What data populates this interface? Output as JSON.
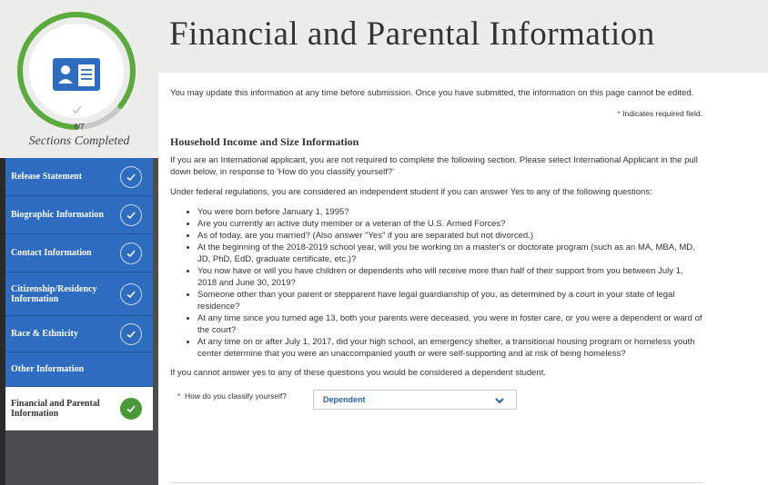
{
  "progress": {
    "count": "6/7",
    "label": "Sections Completed",
    "fraction": 0.857
  },
  "sidebar": {
    "items": [
      {
        "label": "Release Statement",
        "completed": true,
        "active": false
      },
      {
        "label": "Biographic Information",
        "completed": true,
        "active": false
      },
      {
        "label": "Contact Information",
        "completed": true,
        "active": false
      },
      {
        "label": "Citizenship/Residency Information",
        "completed": true,
        "active": false
      },
      {
        "label": "Race & Ethnicity",
        "completed": true,
        "active": false
      },
      {
        "label": "Other Information",
        "completed": false,
        "active": false
      },
      {
        "label": "Financial and Parental Information",
        "completed": true,
        "active": true
      }
    ]
  },
  "header": {
    "title": "Financial and Parental Information"
  },
  "main": {
    "intro": "You may update this information at any time before submission. Once you have submitted, the information on this page cannot be edited.",
    "required_star": "*",
    "required_note": "Indicates required field.",
    "section_heading": "Household Income and Size Information",
    "international_note": "If you are an International applicant, you are not required to complete the following section. Please select International Applicant in the pull down below, in response to 'How do you classify yourself?'",
    "federal_note": "Under federal regulations, you are considered an independent student if you can answer Yes to any of the following questions:",
    "questions": [
      "You were born before January 1, 1995?",
      "Are you currently an active duty member or a veteran of the U.S. Armed Forces?",
      "As of today, are you married? (Also answer \"Yes\" if you are separated but not divorced.)",
      "At the beginning of the 2018-2019 school year, will you be working on a master's or doctorate program (such as an MA, MBA, MD, JD, PhD, EdD, graduate certificate, etc.)?",
      "You now have or will you have children or dependents who will receive more than half of their support from you between July 1, 2018 and June 30, 2019?",
      "Someone other than your parent or stepparent have legal guardianship of you, as determined by a court in your state of legal residence?",
      "At any time since you turned age 13, both your parents were deceased, you were in foster care, or you were a dependent or ward of the court?",
      "At any time on or after July 1, 2017, did your high school, an emergency shelter, a transitional housing program or homeless youth center determine that you were an unaccompanied youth or were self-supporting and at risk of being homeless?"
    ],
    "dependent_note": "If you cannot answer yes to any of these questions you would be considered a dependent student.",
    "classify": {
      "star": "*",
      "label": "How do you classify yourself?",
      "value": "Dependent"
    }
  },
  "colors": {
    "nav_blue": "#2d6cbf",
    "ring_green": "#5aab3c",
    "check_green": "#4a9a3a",
    "required_red": "#d0342c",
    "select_text": "#2d5fa8"
  }
}
